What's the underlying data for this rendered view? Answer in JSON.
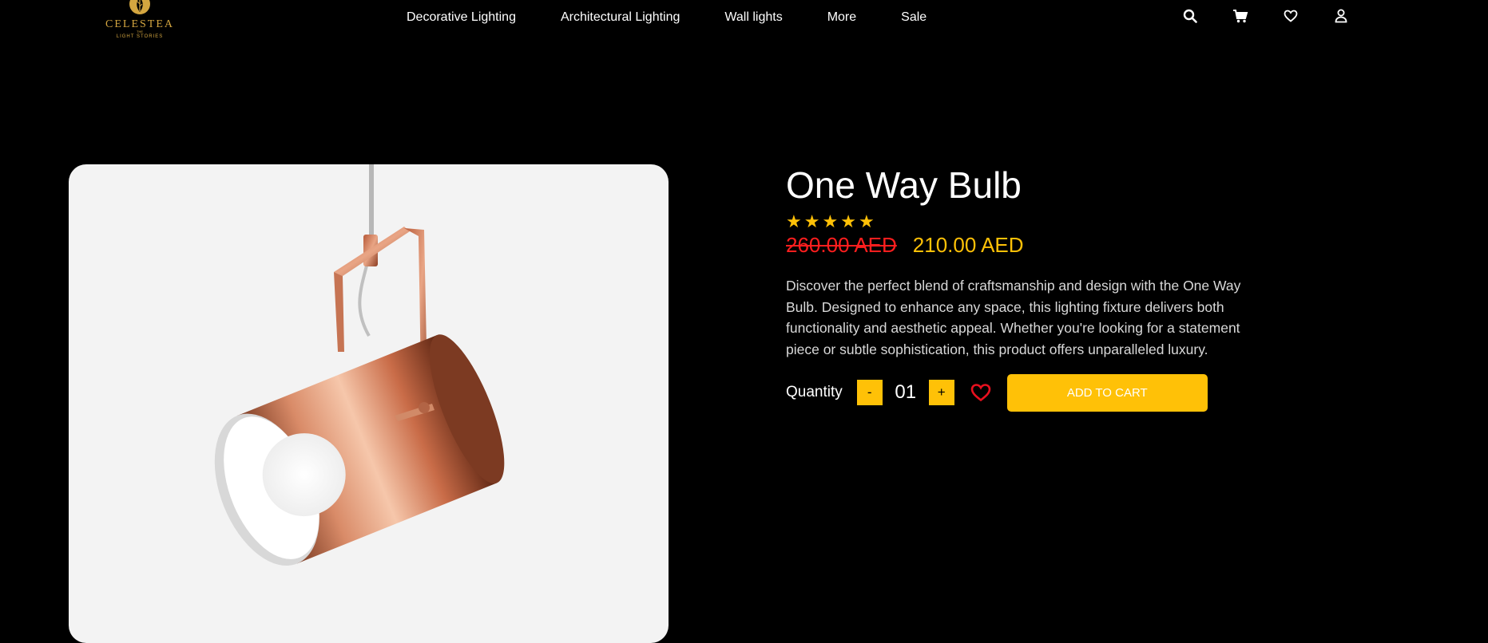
{
  "brand": {
    "name": "CELESTEA",
    "the": "THE",
    "tagline": "LIGHT STORIES"
  },
  "nav": {
    "items": [
      {
        "label": "Decorative Lighting"
      },
      {
        "label": "Architectural Lighting"
      },
      {
        "label": "Wall lights"
      },
      {
        "label": "More"
      },
      {
        "label": "Sale"
      }
    ]
  },
  "header_icons": [
    "search-icon",
    "cart-icon",
    "heart-icon",
    "user-icon"
  ],
  "product": {
    "title": "One Way Bulb",
    "rating": 5,
    "rating_max": 5,
    "old_price": "260.00 AED",
    "new_price": "210.00 AED",
    "description": "Discover the perfect blend of craftsmanship and design with the One Way Bulb. Designed to enhance any space, this lighting fixture delivers both functionality and aesthetic appeal. Whether you're looking for a statement piece or subtle sophistication, this product offers unparalleled luxury."
  },
  "purchase": {
    "quantity_label": "Quantity",
    "decrement_label": "-",
    "quantity_value": "01",
    "increment_label": "+",
    "add_to_cart_label": "ADD TO CART"
  },
  "colors": {
    "background": "#000000",
    "accent": "#ffc107",
    "old_price": "#ff1e1e",
    "wishlist": "#e8101e",
    "image_bg": "#f3f3f3",
    "brand_gold": "#d4a640"
  }
}
